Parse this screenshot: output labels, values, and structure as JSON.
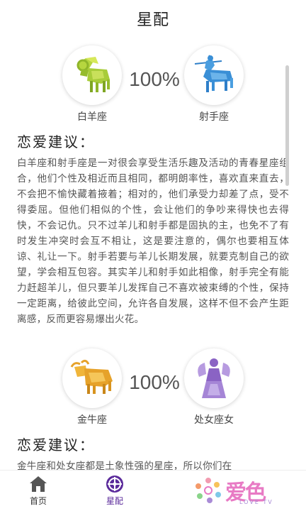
{
  "header": {
    "title": "星配"
  },
  "matches": [
    {
      "left": {
        "name": "白羊座",
        "icon": "aries-ram-icon"
      },
      "right": {
        "name": "射手座",
        "icon": "sagittarius-centaur-icon"
      },
      "percent": "100%",
      "advice_title": "恋爱建议：",
      "advice_text": "白羊座和射手座是一对很会享受生活乐趣及活动的青春星座组合，他们个性及相近而且相同，都明朗率性，喜欢直来直去，不会把不愉快藏着掖着；相对的，他们承受力却差了点，受不得委屈。但他们相似的个性，会让他们的争吵来得快也去得快，不会记仇。只不过羊儿和射手都是固执的主，也免不了有时发生冲突时会互不相让，这是要注意的，偶尔也要相互体谅、礼让一下。射手若要与羊儿长期发展，就要克制自己的欲望，学会相互包容。其实羊儿和射手如此相像，射手完全有能力赶超羊儿，但只要羊儿发挥自己不喜欢被束缚的个性，保持一定距离，给彼此空间，允许各自发展，这样不但不会产生距离感，反而更容易爆出火花。"
    },
    {
      "left": {
        "name": "金牛座",
        "icon": "taurus-bull-icon"
      },
      "right": {
        "name": "处女座女",
        "icon": "virgo-maiden-icon"
      },
      "percent": "100%",
      "advice_title": "恋爱建议：",
      "advice_text": "金牛座和处女座都是土象性强的星座，所以你们在"
    }
  ],
  "tabbar": {
    "home_label": "首页",
    "match_label": "星配",
    "brand_text": "爱色",
    "brand_sub": "LOVE TV"
  },
  "colors": {
    "accent": "#5b2b9b",
    "brand_pink": "#e87ac4",
    "aries_green": "#a8cc3a",
    "sagittarius_blue": "#3a8fd6",
    "taurus_orange": "#e6a22a",
    "virgo_purple": "#8a63c4"
  }
}
